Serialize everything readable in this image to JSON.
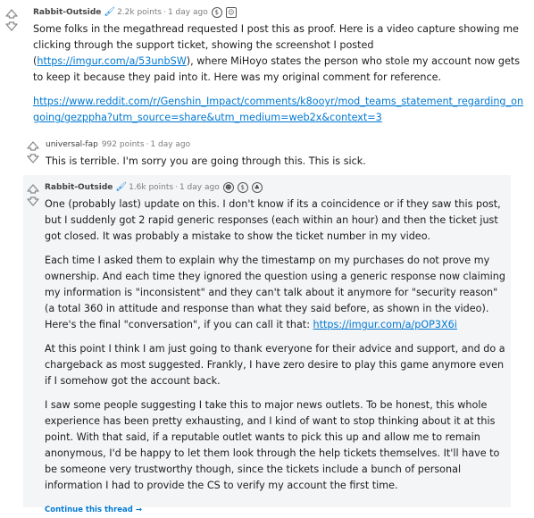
{
  "comments": [
    {
      "author": "Rabbit-Outside",
      "points": "2.2k points",
      "time": "1 day ago",
      "paragraphs": [
        "Some folks in the megathread requested I post this as proof. Here is a video capture showing me clicking through the support ticket, showing the screenshot I posted (",
        "), where MiHoyo states the person who stole my account now gets to keep it because they paid into it. Here was my original comment for reference."
      ],
      "inline_link": "https://imgur.com/a/53unbSW",
      "link": "https://www.reddit.com/r/Genshin_Impact/comments/k8ooyr/mod_teams_statement_regarding_ongoing/gezppha?utm_source=share&utm_medium=web2x&context=3"
    },
    {
      "author": "universal-fap",
      "points": "992 points",
      "time": "1 day ago",
      "text": "This is terrible. I'm sorry you are going through this. This is sick."
    },
    {
      "author": "Rabbit-Outside",
      "points": "1.6k points",
      "time": "1 day ago",
      "p1": "One (probably last) update on this. I don't know if its a coincidence or if they saw this post, but I suddenly got 2 rapid generic responses (each within an hour) and then the ticket just got closed. It was probably a mistake to show the ticket number in my video.",
      "p2": "Each time I asked them to explain why the timestamp on my purchases do not prove my ownership. And each time they ignored the question using a generic response now claiming my information is \"inconsistent\" and they can't talk about it anymore for \"security reason\" (a total 360 in attitude and response than what they said before, as shown in the video). Here's the final \"conversation\", if you can call it that: ",
      "p2_link": "https://imgur.com/a/pOP3X6i",
      "p3": "At this point I think I am just going to thank everyone for their advice and support, and do a chargeback as most suggested. Frankly, I have zero desire to play this game anymore even if I somehow got the account back.",
      "p4": "I saw some people suggesting I take this to major news outlets. To be honest, this whole experience has been pretty exhausting, and I kind of want to stop thinking about it at this point. With that said, if a reputable outlet wants to pick this up and allow me to remain anonymous, I'd be happy to let them look through the help tickets themselves. It'll have to be someone very trustworthy though, since the tickets include a bunch of personal information I had to provide the CS to verify my account the first time."
    }
  ],
  "continue_label": "Continue this thread →",
  "meta_sep": "·"
}
